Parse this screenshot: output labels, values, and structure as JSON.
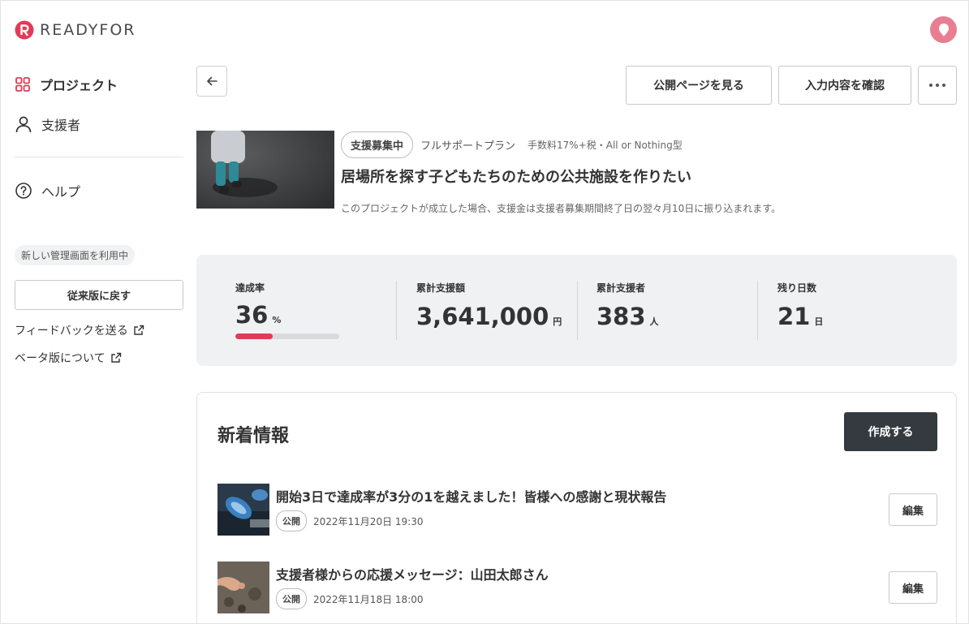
{
  "brand": {
    "name": "READYFOR",
    "accent": "#e23b57",
    "avatar_color": "#e97d92"
  },
  "sidebar": {
    "items": [
      {
        "label": "プロジェクト",
        "icon": "grid-icon",
        "active": true
      },
      {
        "label": "支援者",
        "icon": "person-icon",
        "active": false
      },
      {
        "label": "ヘルプ",
        "icon": "help-circle-icon",
        "active": false
      }
    ],
    "beta_badge": "新しい管理画面を利用中",
    "legacy_button": "従来版に戻す",
    "links": [
      {
        "label": "フィードバックを送る",
        "icon": "external-link-icon"
      },
      {
        "label": "ベータ版について",
        "icon": "external-link-icon"
      }
    ]
  },
  "toolbar": {
    "back_icon": "arrow-left-icon",
    "public_page_label": "公開ページを見る",
    "confirm_label": "入力内容を確認",
    "more_icon": "more-horizontal-icon"
  },
  "project": {
    "status": "支援募集中",
    "plan": "フルサポートプラン",
    "fee": "手数料17%+税・All or Nothing型",
    "title": "居場所を探す子どもたちのための公共施設を作りたい",
    "note": "このプロジェクトが成立した場合、支援金は支援者募集期間終了日の翌々月10日に振り込まれます。"
  },
  "stats": {
    "achievement": {
      "label": "達成率",
      "value": "36",
      "unit": "%",
      "progress": 0.36
    },
    "total_amount": {
      "label": "累計支援額",
      "value": "3,641,000",
      "unit": "円"
    },
    "supporters": {
      "label": "累計支援者",
      "value": "383",
      "unit": "人"
    },
    "days_left": {
      "label": "残り日数",
      "value": "21",
      "unit": "日"
    }
  },
  "updates": {
    "title": "新着情報",
    "create_label": "作成する",
    "items": [
      {
        "title": "開始3日で達成率が3分の1を越えました！皆様への感謝と現状報告",
        "status": "公開",
        "date": "2022年11月20日 19:30",
        "edit_label": "編集"
      },
      {
        "title": "支援者様からの応援メッセージ：山田太郎さん",
        "status": "公開",
        "date": "2022年11月18日 18:00",
        "edit_label": "編集"
      }
    ]
  }
}
